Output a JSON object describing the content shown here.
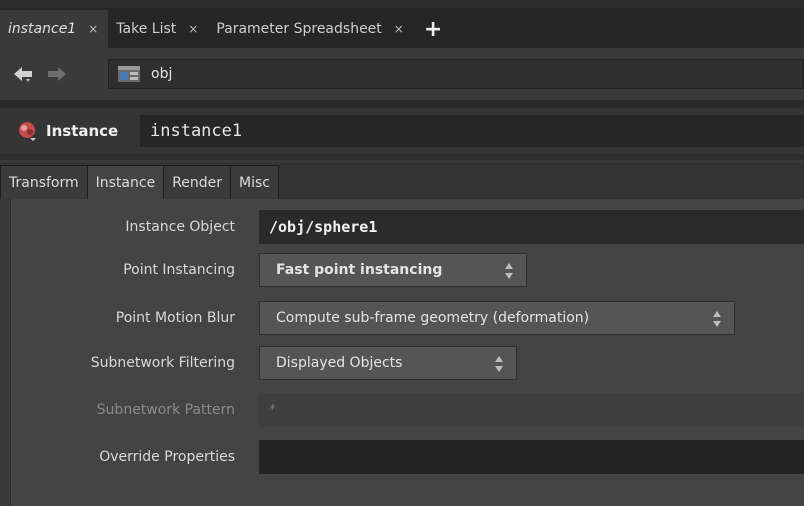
{
  "pane_tabs": [
    {
      "label": "instance1",
      "close": "×",
      "active": true
    },
    {
      "label": "Take List",
      "close": "×",
      "active": false
    },
    {
      "label": "Parameter Spreadsheet",
      "close": "×",
      "active": false
    }
  ],
  "add_tab": "+",
  "path": {
    "value": "obj"
  },
  "node": {
    "type": "Instance",
    "name": "instance1"
  },
  "param_tabs": [
    "Transform",
    "Instance",
    "Render",
    "Misc"
  ],
  "params": {
    "instance_object": {
      "label": "Instance Object",
      "value": "/obj/sphere1"
    },
    "point_instancing": {
      "label": "Point Instancing",
      "value": "Fast point instancing"
    },
    "point_motion_blur": {
      "label": "Point Motion Blur",
      "value": "Compute sub-frame geometry (deformation)"
    },
    "subnetwork_filtering": {
      "label": "Subnetwork Filtering",
      "value": "Displayed Objects"
    },
    "subnetwork_pattern": {
      "label": "Subnetwork Pattern",
      "value": "*"
    },
    "override_properties": {
      "label": "Override Properties",
      "value": ""
    }
  }
}
